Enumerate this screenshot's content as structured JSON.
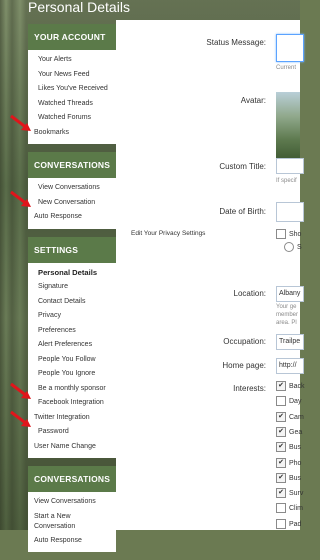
{
  "page_title": "Personal Details",
  "sidebar": {
    "account": {
      "heading": "YOUR ACCOUNT",
      "items": [
        "Your Alerts",
        "Your News Feed",
        "Likes You've Received",
        "Watched Threads",
        "Watched Forums",
        "Bookmarks"
      ]
    },
    "conversations": {
      "heading": "CONVERSATIONS",
      "items": [
        "View Conversations",
        "New Conversation",
        "Auto Response"
      ]
    },
    "settings": {
      "heading": "SETTINGS",
      "items": [
        "Personal Details",
        "Signature",
        "Contact Details",
        "Privacy",
        "Preferences",
        "Alert Preferences",
        "People You Follow",
        "People You Ignore",
        "Be a monthly sponsor",
        "Facebook Integration",
        "Twitter Integration",
        "Password",
        "User Name Change"
      ]
    },
    "conversations2": {
      "heading": "CONVERSATIONS",
      "items": [
        "View Conversations",
        "Start a New Conversation",
        "Auto Response"
      ]
    }
  },
  "form": {
    "status_label": "Status Message:",
    "status_hint": "Current",
    "avatar_label": "Avatar:",
    "custom_title_label": "Custom Title:",
    "custom_title_hint": "If specif",
    "dob_label": "Date of Birth:",
    "privacy_label": "Edit Your Privacy Settings",
    "privacy_option1": "Sho",
    "privacy_option2": "S",
    "location_label": "Location:",
    "location_value": "Albany",
    "location_hint1": "Your ge",
    "location_hint2": "member",
    "location_hint3": "area. Pl",
    "occupation_label": "Occupation:",
    "occupation_value": "Trailpe",
    "homepage_label": "Home page:",
    "homepage_value": "http://",
    "interests_label": "Interests:",
    "interests": [
      {
        "label": "Back",
        "checked": true
      },
      {
        "label": "Day",
        "checked": false
      },
      {
        "label": "Cam",
        "checked": true
      },
      {
        "label": "Gea",
        "checked": true
      },
      {
        "label": "Bus",
        "checked": true
      },
      {
        "label": "Pho",
        "checked": true
      },
      {
        "label": "Bus",
        "checked": true
      },
      {
        "label": "Surv",
        "checked": true
      },
      {
        "label": "Clim",
        "checked": false
      },
      {
        "label": "Pad",
        "checked": false
      }
    ]
  },
  "colors": {
    "block_header": "#5b7a49",
    "arrow": "#e0151b",
    "field_focus": "#5ba3ff"
  }
}
